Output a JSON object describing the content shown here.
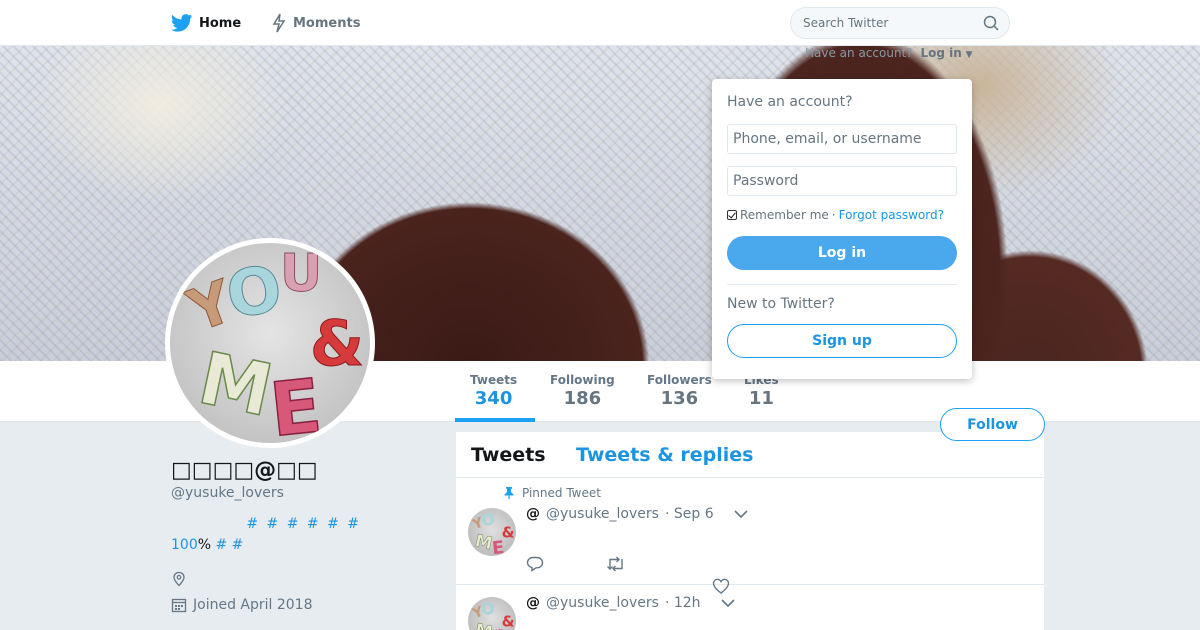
{
  "nav": {
    "home_label": "Home",
    "moments_label": "Moments",
    "search_placeholder": "Search Twitter"
  },
  "account": {
    "hint": "Have an account?",
    "login_link": "Log in"
  },
  "login_dropdown": {
    "heading": "Have an account?",
    "username_placeholder": "Phone, email, or username",
    "password_placeholder": "Password",
    "remember_label": "Remember me",
    "separator": "·",
    "forgot_label": "Forgot password?",
    "login_button": "Log in",
    "new_heading": "New to Twitter?",
    "signup_button": "Sign up"
  },
  "stats": [
    {
      "label": "Tweets",
      "value": "340"
    },
    {
      "label": "Following",
      "value": "186"
    },
    {
      "label": "Followers",
      "value": "136"
    },
    {
      "label": "Likes",
      "value": "11"
    }
  ],
  "follow_button": "Follow",
  "profile": {
    "name": "□□□□@□□",
    "handle": "@yusuke_lovers",
    "bio_line1": "# # # # # #",
    "bio_num": "100",
    "bio_pct": "% ",
    "bio_tags": "# #",
    "joined": "Joined April 2018"
  },
  "timeline": {
    "tab_tweets": "Tweets",
    "tab_replies": "Tweets & replies",
    "pinned_label": "Pinned Tweet",
    "tweets": [
      {
        "at": "@",
        "handle": "@yusuke_lovers",
        "time": "· Sep 6"
      },
      {
        "at": "@",
        "handle": "@yusuke_lovers",
        "time": "· 12h"
      }
    ]
  },
  "colors": {
    "accent": "#1da1f2",
    "link": "#1b95e0",
    "login_button": "#4aa8ec",
    "background": "#e6ecf0"
  },
  "icons": [
    "twitter-bird-icon",
    "lightning-icon",
    "search-icon",
    "caret-down-icon",
    "pin-icon",
    "location-icon",
    "calendar-icon",
    "reply-icon",
    "retweet-icon",
    "heart-icon",
    "chevron-down-icon"
  ]
}
